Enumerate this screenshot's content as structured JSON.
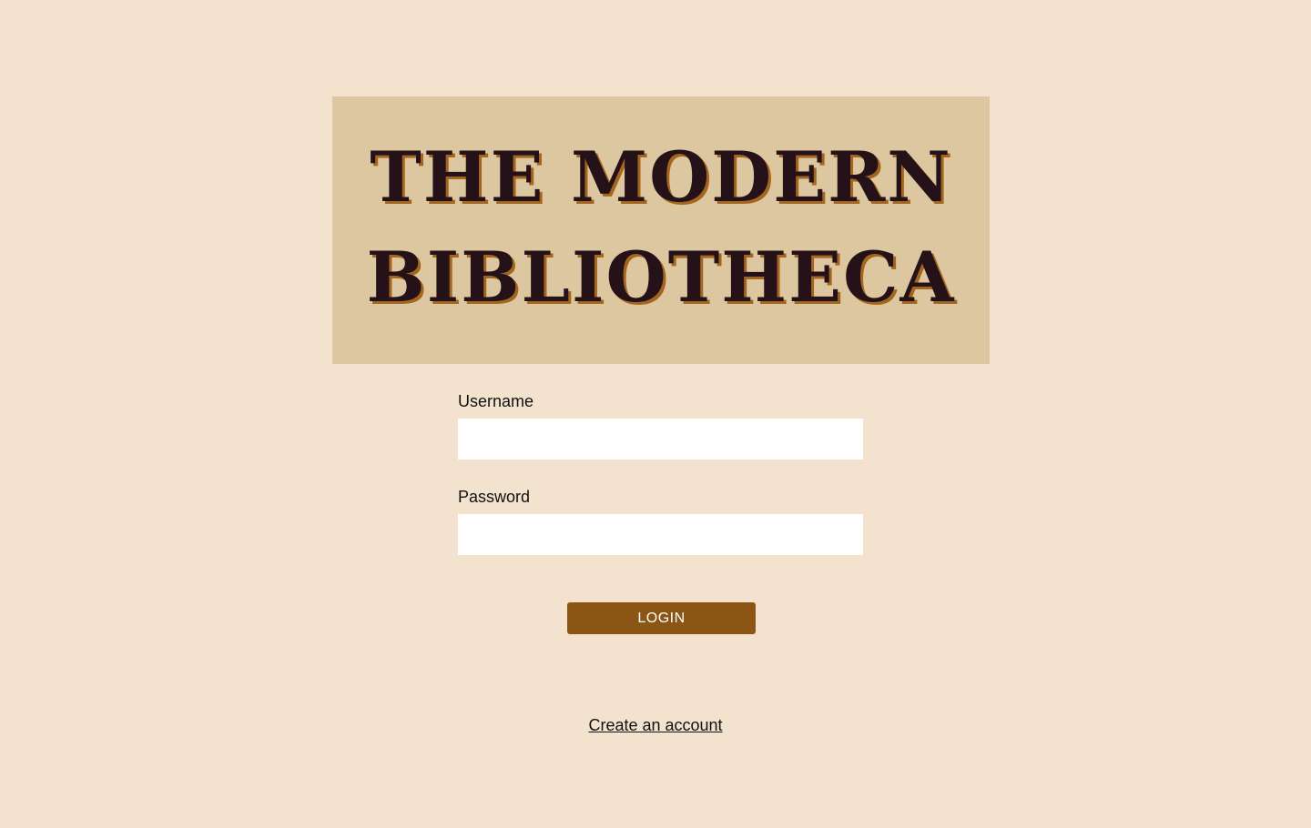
{
  "header": {
    "title_line1": "THE MODERN",
    "title_line2": "BIBLIOTHECA"
  },
  "form": {
    "username_label": "Username",
    "username_value": "",
    "password_label": "Password",
    "password_value": "",
    "login_label": "LOGIN"
  },
  "footer": {
    "create_account_label": "Create an account"
  },
  "colors": {
    "background": "#f3e3ce",
    "banner": "#dcc7a1",
    "title_text": "#241218",
    "title_shadow": "#a4661e",
    "button": "#8b5614"
  }
}
